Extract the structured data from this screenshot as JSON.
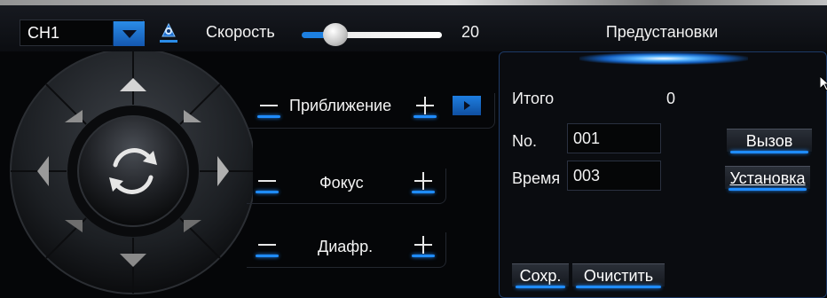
{
  "toolbar": {
    "channel_value": "CH1",
    "speed_label": "Скорость",
    "speed_value": "20",
    "speed_level_percent": 20,
    "presets_title": "Предустановки"
  },
  "ptz": {
    "zoom_label": "Приближение",
    "focus_label": "Фокус",
    "iris_label": "Диафр."
  },
  "presets": {
    "total_label": "Итого",
    "total_value": "0",
    "no_label": "No.",
    "no_value": "001",
    "time_label": "Время",
    "time_value": "003",
    "call_button": "Вызов",
    "set_button": "Установка",
    "save_button": "Сохр.",
    "clear_button": "Очистить"
  },
  "colors": {
    "accent": "#1f8cff",
    "background": "#050608",
    "panel_border": "#1d3a66"
  },
  "icons": [
    "chevron-down-icon",
    "camera-icon",
    "arrow-up-icon",
    "arrow-down-icon",
    "arrow-left-icon",
    "arrow-right-icon",
    "rotate-icon",
    "play-icon",
    "minus-icon",
    "plus-icon",
    "cursor-icon"
  ]
}
